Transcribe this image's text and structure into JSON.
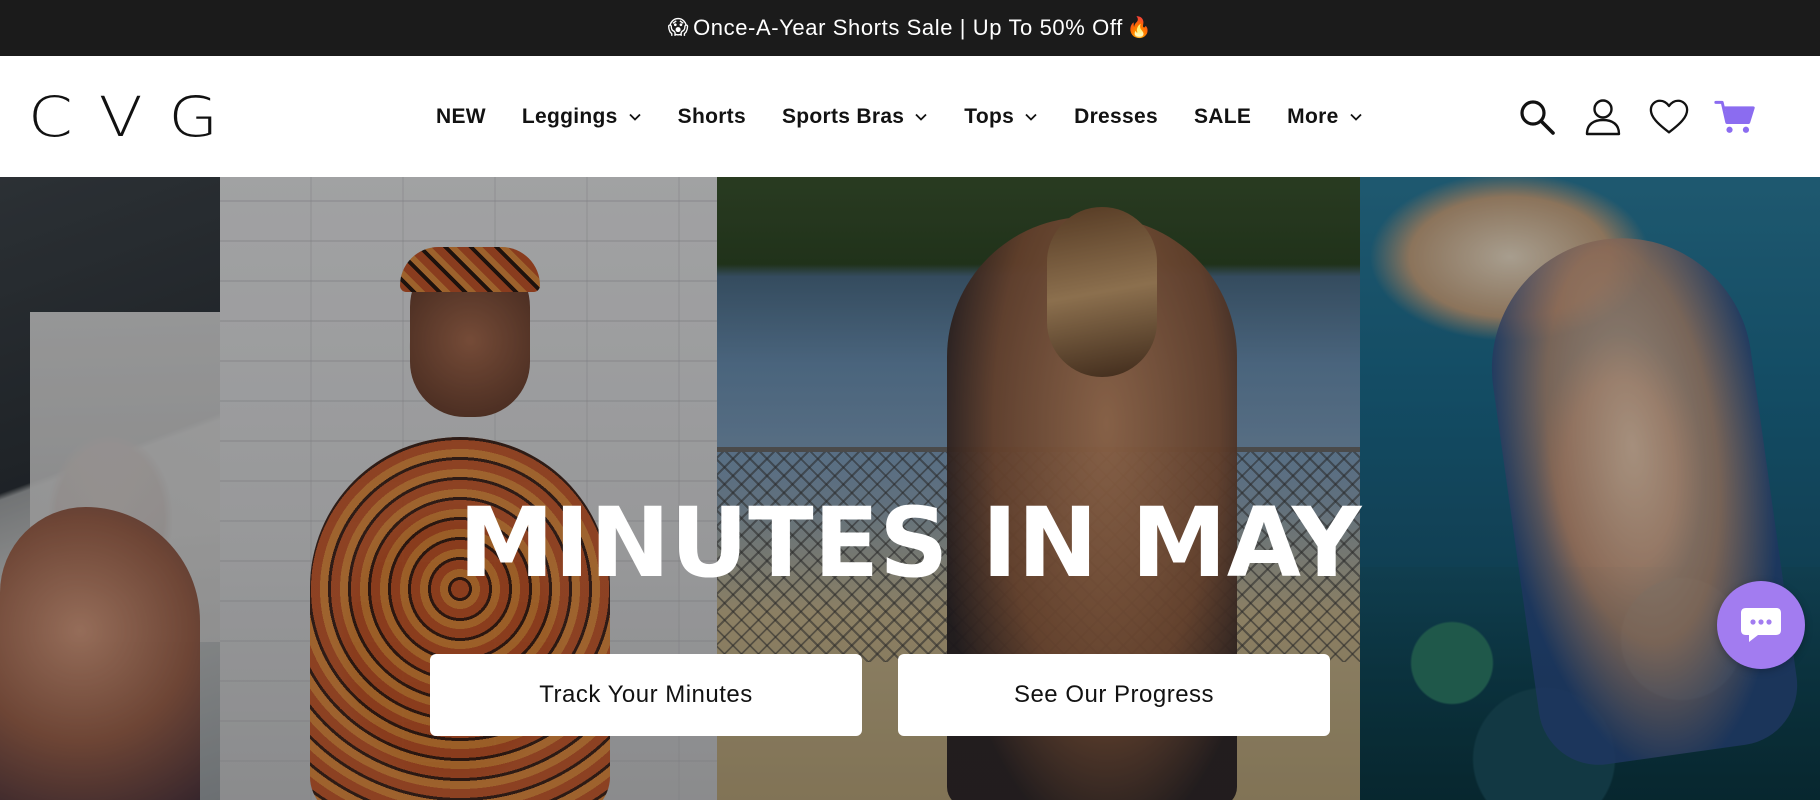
{
  "announcement": {
    "emoji_left": "😱",
    "text": "Once-A-Year Shorts Sale | Up To 50% Off",
    "emoji_right": "🔥"
  },
  "header": {
    "logo": "CVG",
    "nav": [
      {
        "label": "NEW",
        "dropdown": false
      },
      {
        "label": "Leggings",
        "dropdown": true
      },
      {
        "label": "Shorts",
        "dropdown": false
      },
      {
        "label": "Sports Bras",
        "dropdown": true
      },
      {
        "label": "Tops",
        "dropdown": true
      },
      {
        "label": "Dresses",
        "dropdown": false
      },
      {
        "label": "SALE",
        "dropdown": false
      },
      {
        "label": "More",
        "dropdown": true
      }
    ],
    "icons": [
      "search-icon",
      "account-icon",
      "wishlist-heart-icon",
      "cart-icon"
    ],
    "cart_color": "#8b6cf0"
  },
  "hero": {
    "title": "MINUTES IN MAY",
    "buttons": [
      {
        "label": "Track Your Minutes"
      },
      {
        "label": "See Our Progress"
      }
    ]
  },
  "chat": {
    "icon": "chat-bubble-icon",
    "color": "#a27cf0"
  }
}
